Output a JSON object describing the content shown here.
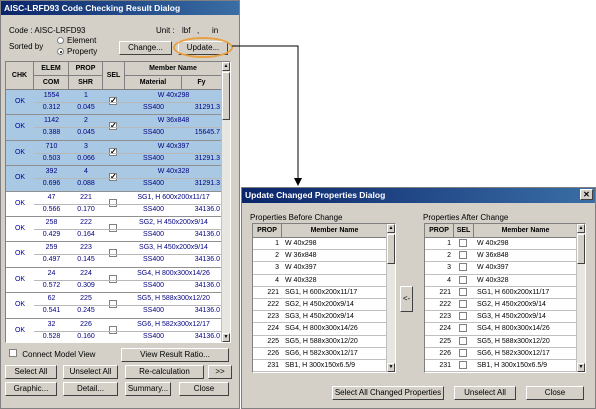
{
  "left_dialog": {
    "title": "AISC-LRFD93 Code Checking Result Dialog",
    "code_label": "Code : AISC-LRFD93",
    "unit_label": "Unit :",
    "unit_force": "lbf",
    "unit_sep": ",",
    "unit_length": "in",
    "sorted_by_label": "Sorted by",
    "radio_element": "Element",
    "radio_property": "Property",
    "change_button": "Change...",
    "update_button": "Update...",
    "table": {
      "headers": {
        "chk": "CHK",
        "elem": "ELEM",
        "com": "COM",
        "prop": "PROP",
        "shr": "SHR",
        "sel": "SEL",
        "member_name": "Member Name",
        "material": "Material",
        "fy": "Fy"
      },
      "rows": [
        {
          "chk": "OK",
          "elem": "1554",
          "prop": "1",
          "com": "0.312",
          "shr": "0.045",
          "sel": "✓",
          "member": "W 40x298",
          "material": "SS400",
          "fy": "31291.3",
          "selected": true
        },
        {
          "chk": "OK",
          "elem": "1142",
          "prop": "2",
          "com": "0.388",
          "shr": "0.045",
          "sel": "✓",
          "member": "W 36x848",
          "material": "SS400",
          "fy": "15645.7",
          "selected": true
        },
        {
          "chk": "OK",
          "elem": "710",
          "prop": "3",
          "com": "0.503",
          "shr": "0.066",
          "sel": "✓",
          "member": "W 40x397",
          "material": "SS400",
          "fy": "31291.3",
          "selected": true
        },
        {
          "chk": "OK",
          "elem": "392",
          "prop": "4",
          "com": "0.696",
          "shr": "0.088",
          "sel": "✓",
          "member": "W 40x328",
          "material": "SS400",
          "fy": "31291.3",
          "selected": true
        },
        {
          "chk": "OK",
          "elem": "47",
          "prop": "221",
          "com": "0.566",
          "shr": "0.170",
          "sel": "",
          "member": "SG1, H 600x200x11/17",
          "material": "SS400",
          "fy": "34136.0",
          "selected": false
        },
        {
          "chk": "OK",
          "elem": "258",
          "prop": "222",
          "com": "0.429",
          "shr": "0.164",
          "sel": "",
          "member": "SG2, H 450x200x9/14",
          "material": "SS400",
          "fy": "34136.0",
          "selected": false
        },
        {
          "chk": "OK",
          "elem": "259",
          "prop": "223",
          "com": "0.497",
          "shr": "0.145",
          "sel": "",
          "member": "SG3, H 450x200x9/14",
          "material": "SS400",
          "fy": "34136.0",
          "selected": false
        },
        {
          "chk": "OK",
          "elem": "24",
          "prop": "224",
          "com": "0.572",
          "shr": "0.309",
          "sel": "",
          "member": "SG4, H 800x300x14/26",
          "material": "SS400",
          "fy": "34136.0",
          "selected": false
        },
        {
          "chk": "OK",
          "elem": "62",
          "prop": "225",
          "com": "0.541",
          "shr": "0.245",
          "sel": "",
          "member": "SG5, H 588x300x12/20",
          "material": "SS400",
          "fy": "34136.0",
          "selected": false
        },
        {
          "chk": "OK",
          "elem": "32",
          "prop": "226",
          "com": "0.528",
          "shr": "0.160",
          "sel": "",
          "member": "SG6, H 582x300x12/17",
          "material": "SS400",
          "fy": "34136.0",
          "selected": false
        }
      ]
    },
    "connect_model_view": "Connect Model View",
    "view_result_ratio": "View Result Ratio...",
    "select_all": "Select All",
    "unselect_all": "Unselect All",
    "re_calculation": "Re-calculation",
    "more": ">>",
    "graphic": "Graphic...",
    "detail": "Detail...",
    "summary": "Summary...",
    "close": "Close"
  },
  "right_dialog": {
    "title": "Update Changed Properties Dialog",
    "before_label": "Properties Before Change",
    "after_label": "Properties After Change",
    "before_headers": {
      "prop": "PROP",
      "member_name": "Member Name"
    },
    "after_headers": {
      "prop": "PROP",
      "sel": "SEL",
      "member_name": "Member Name"
    },
    "rows": [
      {
        "prop": "1",
        "member": "W 40x298"
      },
      {
        "prop": "2",
        "member": "W 36x848"
      },
      {
        "prop": "3",
        "member": "W 40x397"
      },
      {
        "prop": "4",
        "member": "W 40x328"
      },
      {
        "prop": "221",
        "member": "SG1, H 600x200x11/17"
      },
      {
        "prop": "222",
        "member": "SG2, H 450x200x9/14"
      },
      {
        "prop": "223",
        "member": "SG3, H 450x200x9/14"
      },
      {
        "prop": "224",
        "member": "SG4, H 800x300x14/26"
      },
      {
        "prop": "225",
        "member": "SG5, H 588x300x12/20"
      },
      {
        "prop": "226",
        "member": "SG6, H 582x300x12/17"
      },
      {
        "prop": "231",
        "member": "SB1, H 300x150x6.5/9"
      }
    ],
    "transfer_button": "<-",
    "select_all_changed": "Select All Changed Properties",
    "unselect_all": "Unselect All",
    "close": "Close"
  },
  "colors": {
    "selected_row": "#a9c8e4",
    "titlebar": "#0a246a",
    "callout": "#e8a040"
  }
}
